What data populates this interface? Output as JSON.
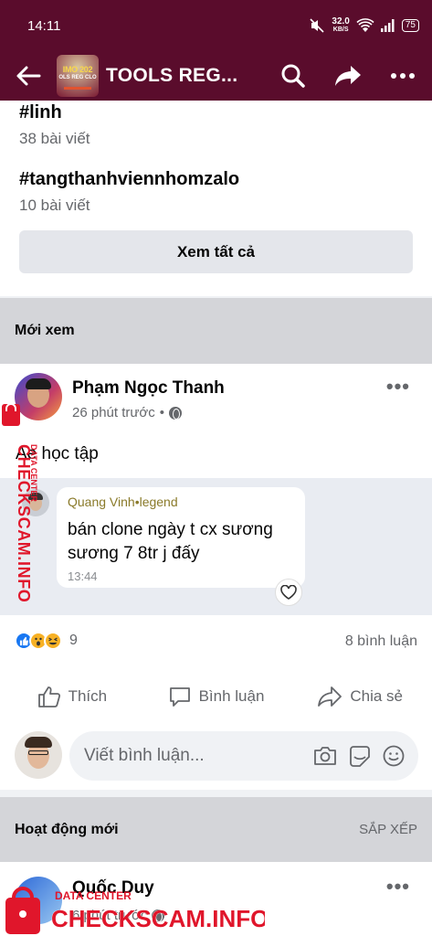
{
  "status_bar": {
    "time": "14:11",
    "speed": "32.0",
    "speed_unit": "KB/S",
    "battery": "75"
  },
  "header": {
    "title": "TOOLS REG...",
    "logo_text_line1": "IMO 202",
    "logo_text_line2": "OLS REG CLO"
  },
  "hashtags": [
    {
      "tag": "#linh",
      "count": "38 bài viết"
    },
    {
      "tag": "#tangthanhviennhomzalo",
      "count": "10 bài viết"
    }
  ],
  "see_all_label": "Xem tất cả",
  "recent_section_label": "Mới xem",
  "post": {
    "author": "Phạm Ngọc Thanh",
    "time": "26 phút trước",
    "separator": "•",
    "text": "Ae học tập",
    "shared_comment": {
      "author": "Quang Vinh•legend",
      "text": "bán clone ngày t cx sương sương 7 8tr j đấy",
      "time": "13:44"
    },
    "reaction_count": "9",
    "comment_count": "8 bình luận",
    "actions": {
      "like": "Thích",
      "comment": "Bình luận",
      "share": "Chia sẻ"
    },
    "comment_placeholder": "Viết bình luận..."
  },
  "activity_section": {
    "label": "Hoạt động mới",
    "sort_label": "SẮP XẾP"
  },
  "post2": {
    "author": "Quốc Duy",
    "time": "6 phút trước"
  },
  "watermark": {
    "brand": "CHECKSCAM.INFO",
    "sub": "DATA CENTER"
  },
  "colors": {
    "header_bg": "#5a0c2c",
    "watermark_red": "#e0162b",
    "link_blue": "#1877f2"
  }
}
